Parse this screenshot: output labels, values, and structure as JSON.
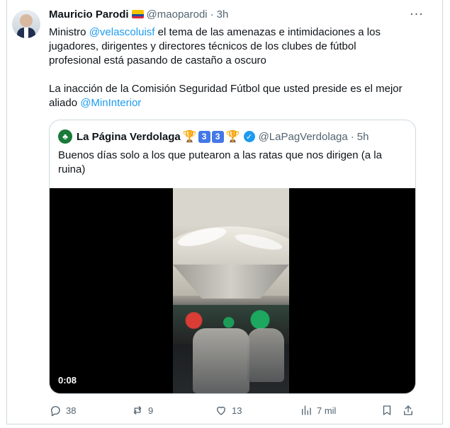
{
  "tweet": {
    "display_name": "Mauricio Parodi",
    "flag_icon": "colombia-flag-icon",
    "handle": "@maoparodi",
    "separator": "·",
    "time": "3h",
    "more_icon": "ellipsis-icon",
    "text": {
      "part1": "Ministro ",
      "mention1": "@velascoluisf",
      "part2": " el tema de las amenazas e intimidaciones a los jugadores, dirigentes y directores técnicos de los clubes de fútbol profesional está pasando de castaño a oscuro",
      "part3": "La inacción de la Comisión Seguridad Fútbol que usted preside es el mejor aliado ",
      "mention2": "@MinInterior"
    }
  },
  "quote": {
    "display_name": "La Página Verdolaga",
    "badges": [
      "🏆",
      "3",
      "3",
      "🏆"
    ],
    "verified_icon": "verified-check-icon",
    "handle": "@LaPagVerdolaga",
    "separator": "·",
    "time": "5h",
    "text": "Buenos días solo a los que putearon a las ratas que nos dirigen (a la ruina)",
    "video": {
      "duration": "0:08"
    }
  },
  "actions": {
    "replies": "38",
    "reposts": "9",
    "likes": "13",
    "views": "7 mil"
  },
  "colors": {
    "link": "#1d9bf0",
    "muted_text": "#536471",
    "border": "#cfd9de"
  }
}
